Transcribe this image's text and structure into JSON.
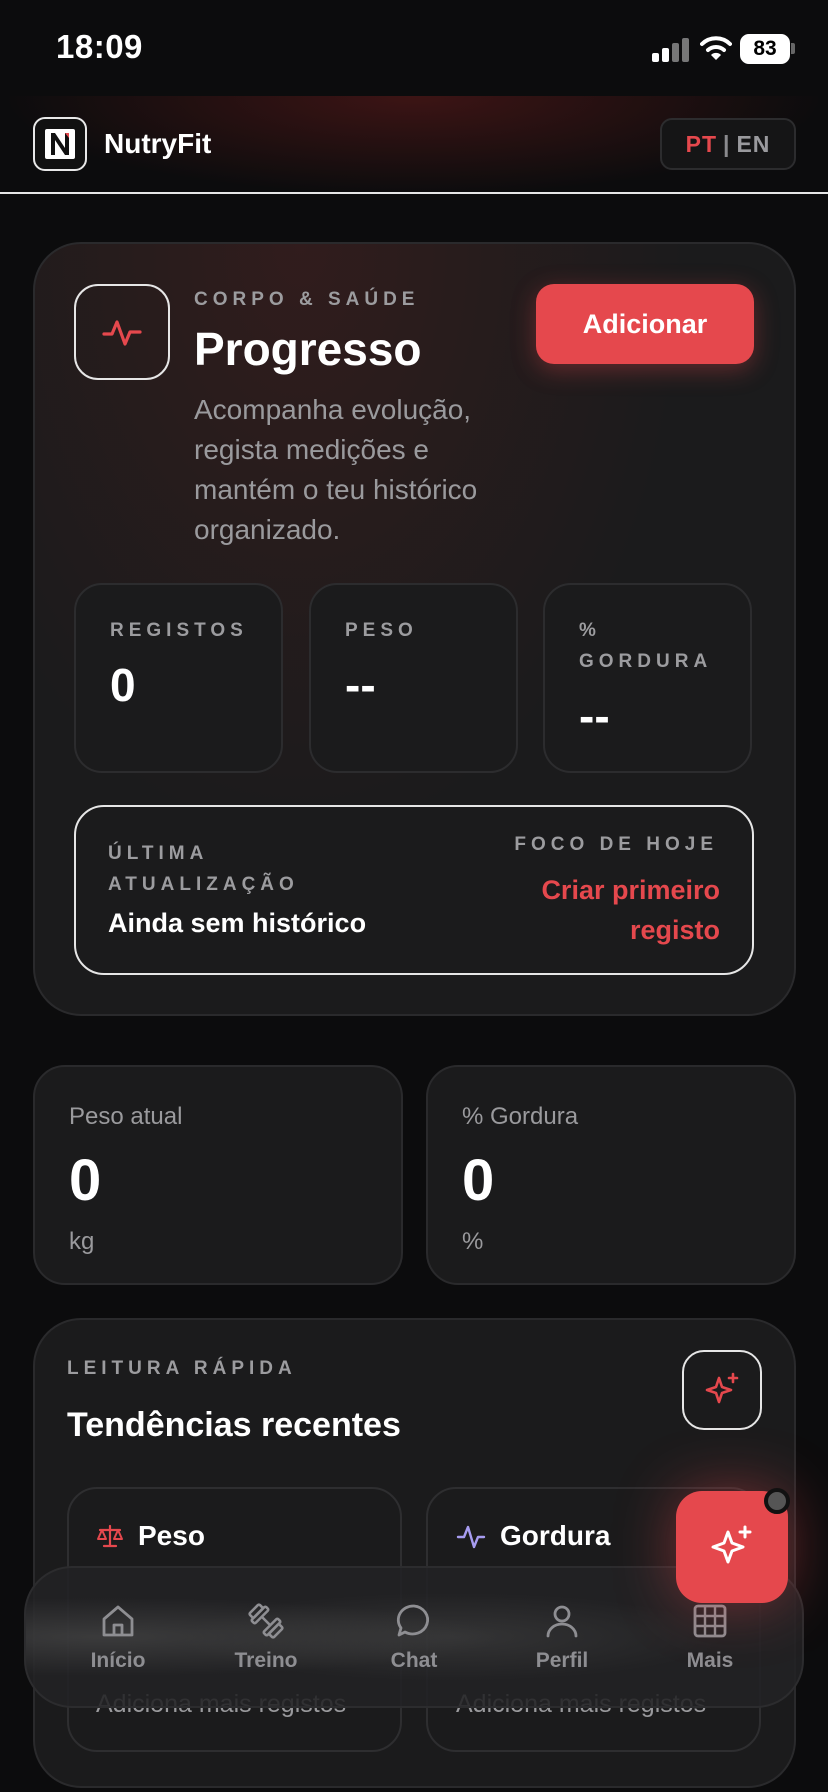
{
  "status_bar": {
    "time": "18:09",
    "battery": "83"
  },
  "header": {
    "logo_letter": "N",
    "app_name": "NutryFit",
    "lang_active": "PT",
    "lang_separator": "|",
    "lang_inactive": "EN"
  },
  "hero": {
    "overline": "CORPO & SAÚDE",
    "title": "Progresso",
    "description": "Acompanha evolução, regista medições e mantém o teu histórico organizado.",
    "add_button": "Adicionar",
    "stats": [
      {
        "label": "REGISTOS",
        "value": "0"
      },
      {
        "label": "PESO",
        "value": "--"
      },
      {
        "label": "% GORDURA",
        "value": "--"
      }
    ],
    "last_update_label": "ÚLTIMA ATUALIZAÇÃO",
    "last_update_value": "Ainda sem histórico",
    "focus_label": "FOCO DE HOJE",
    "focus_value": "Criar primeiro registo"
  },
  "metrics": [
    {
      "label": "Peso atual",
      "value": "0",
      "unit": "kg"
    },
    {
      "label": "% Gordura",
      "value": "0",
      "unit": "%"
    }
  ],
  "trends": {
    "overline": "LEITURA RÁPIDA",
    "title": "Tendências recentes",
    "cards": [
      {
        "title": "Peso",
        "footer": "Adiciona mais registos"
      },
      {
        "title": "Gordura",
        "footer": "Adiciona mais registos"
      }
    ]
  },
  "nav": {
    "items": [
      {
        "label": "Início",
        "icon": "home-icon"
      },
      {
        "label": "Treino",
        "icon": "dumbbell-icon"
      },
      {
        "label": "Chat",
        "icon": "chat-icon"
      },
      {
        "label": "Perfil",
        "icon": "user-icon"
      },
      {
        "label": "Mais",
        "icon": "grid-icon"
      }
    ]
  },
  "colors": {
    "accent": "#e5484d",
    "background": "#0c0c0d",
    "card": "#1b1b1c",
    "gordura_icon": "#a79cf0"
  }
}
